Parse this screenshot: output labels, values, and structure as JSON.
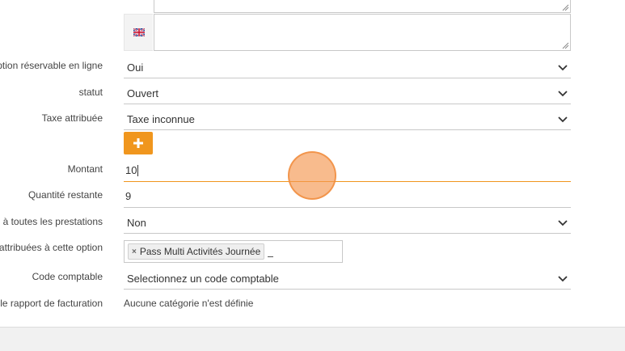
{
  "form": {
    "rows": [
      {
        "label": "ption réservable en ligne",
        "value": "Oui"
      },
      {
        "label": "statut",
        "value": "Ouvert"
      },
      {
        "label": "Taxe attribuée",
        "value": "Taxe inconnue"
      },
      {
        "label": "Montant",
        "value": "10"
      },
      {
        "label": "Quantité restante",
        "value": "9"
      },
      {
        "label": "n à toutes les prestations",
        "value": "Non"
      },
      {
        "label": "attribuées à cette option",
        "tag": "Pass Multi Activités Journée"
      },
      {
        "label": "Code comptable",
        "value": "Selectionnez un code comptable"
      },
      {
        "label": "le rapport de facturation",
        "value": "Aucune catégorie n'est définie"
      }
    ],
    "add_button_symbol": "+",
    "tag_remove_symbol": "×"
  },
  "colors": {
    "accent": "#f0961e",
    "active_underline": "#f0961e",
    "click_marker": "#f5a060"
  },
  "icons": {
    "flag": "uk-flag-icon",
    "chevron": "chevron-down-icon",
    "resize": "resize-handle-icon",
    "plus": "plus-icon"
  }
}
